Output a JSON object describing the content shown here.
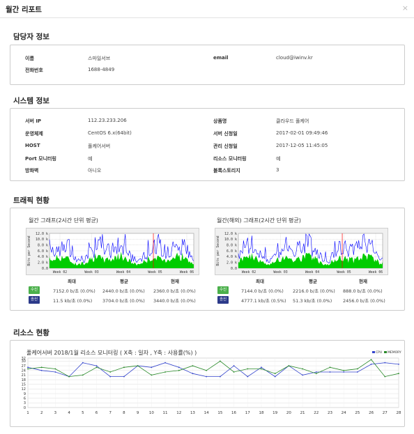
{
  "modal": {
    "title": "월간 리포트",
    "close_icon": "×"
  },
  "manager": {
    "heading": "담당자 정보",
    "name_label": "이름",
    "name_value": "스마일서브",
    "email_label": "email",
    "email_value": "cloud@iwinv.kr",
    "phone_label": "전화번호",
    "phone_value": "1688-4849"
  },
  "system": {
    "heading": "시스템 정보",
    "rows": [
      {
        "l1": "서버 IP",
        "v1": "112.23.233.206",
        "l2": "상품명",
        "v2": "클라우드 풀케어"
      },
      {
        "l1": "운영체제",
        "v1": "CentOS 6.x(64bit)",
        "l2": "서버 신청일",
        "v2": "2017-02-01 09:49:46"
      },
      {
        "l1": "HOST",
        "v1": "풀케어서버",
        "l2": "관리 신청일",
        "v2": "2017-12-05 11:45:05"
      },
      {
        "l1": "Port 모니터링",
        "v1": "예",
        "l2": "리소스 모니터링",
        "v2": "예"
      },
      {
        "l1": "방화벽",
        "v1": "아니오",
        "l2": "블록스토리지",
        "v2": "3"
      }
    ]
  },
  "traffic": {
    "heading": "트래픽 현황",
    "graphs": [
      {
        "title": "월간 그래프(2시간 단위 평균)",
        "y_axis_label": "Bits per Second",
        "y_ticks": [
          "12.0 k",
          "10.0 k",
          "8.0 k",
          "6.0 k",
          "4.0 k",
          "2.0 k",
          "0.0"
        ],
        "x_ticks": [
          "Week 02",
          "Week 03",
          "Week 04",
          "Week 05",
          "Week 06"
        ],
        "headers": [
          "최대",
          "평균",
          "현재"
        ],
        "rx_label": "수신",
        "tx_label": "송신",
        "rx": [
          "7152.0 b/초 (0.0%)",
          "2440.0 b/초 (0.0%)",
          "2360.0 b/초 (0.0%)"
        ],
        "tx": [
          "11.5 kb/초 (0.0%)",
          "3704.0 b/초 (0.0%)",
          "3440.0 b/초 (0.0%)"
        ]
      },
      {
        "title": "월간(해외) 그래프(2시간 단위 평균)",
        "y_axis_label": "Bits per Second",
        "y_ticks": [
          "12.0 k",
          "10.0 k",
          "8.0 k",
          "6.0 k",
          "4.0 k",
          "2.0 k",
          "0.0"
        ],
        "x_ticks": [
          "Week 02",
          "Week 03",
          "Week 04",
          "Week 05",
          "Week 06"
        ],
        "headers": [
          "최대",
          "평균",
          "현재"
        ],
        "rx_label": "수신",
        "tx_label": "송신",
        "rx": [
          "7144.0 b/초 (0.0%)",
          "2216.0 b/초 (0.0%)",
          "888.0 b/초 (0.0%)"
        ],
        "tx": [
          "4777.1 kb/초 (0.5%)",
          "51.3 kb/초 (0.0%)",
          "2456.0 b/초 (0.0%)"
        ]
      }
    ],
    "colors": {
      "rx": "#00cc00",
      "tx": "#0000ff",
      "now_marker": "#ff0000"
    }
  },
  "resource": {
    "heading": "리소스 현황",
    "chart_title": "풀케어서버 2018/1월  리소스 모니터링 ( X축 : 일자 , Y축 : 사용률(%) )",
    "legend": [
      "CPU",
      "MEMORY"
    ]
  },
  "chart_data": {
    "type": "line",
    "x": [
      1,
      2,
      3,
      4,
      5,
      6,
      7,
      8,
      9,
      10,
      11,
      12,
      13,
      14,
      15,
      16,
      17,
      18,
      19,
      20,
      21,
      22,
      23,
      24,
      25,
      26,
      27,
      28
    ],
    "ylim": [
      0,
      32
    ],
    "yticks": [
      0,
      3,
      6,
      9,
      12,
      15,
      18,
      21,
      24,
      27,
      30,
      32
    ],
    "series": [
      {
        "name": "CPU",
        "color": "#3344cc",
        "values": [
          26,
          24,
          23,
          20,
          29,
          27,
          20,
          20,
          27,
          26,
          29,
          26,
          22,
          20,
          20,
          27,
          20,
          26,
          20,
          27,
          21,
          23,
          23,
          23,
          23,
          28,
          29,
          28
        ]
      },
      {
        "name": "MEMORY",
        "color": "#2a8a2a",
        "values": [
          25,
          26,
          25,
          20,
          21,
          26,
          23,
          26,
          27,
          21,
          23,
          24,
          27,
          24,
          30,
          23,
          25,
          25,
          22,
          27,
          25,
          22,
          26,
          24,
          25,
          31,
          20,
          22
        ]
      }
    ]
  }
}
